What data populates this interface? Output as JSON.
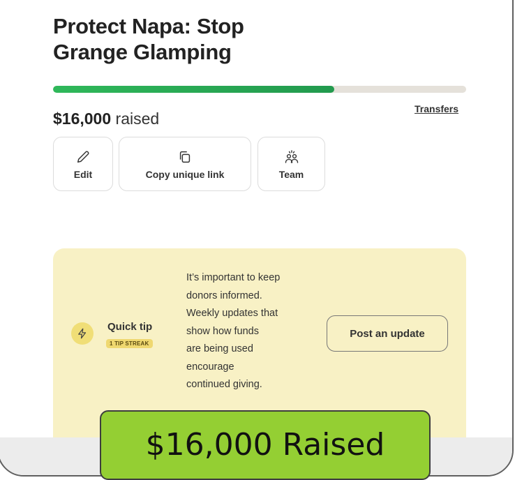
{
  "campaign": {
    "title_line1": "Protect Napa: Stop",
    "title_line2": "Grange Glamping",
    "progress_fraction": 0.68,
    "raised_amount": "$16,000",
    "raised_suffix": " raised",
    "transfers_link": "Transfers"
  },
  "actions": {
    "edit": "Edit",
    "copy_link": "Copy unique link",
    "team": "Team"
  },
  "tip": {
    "label": "Quick tip",
    "streak": "1 TIP STREAK",
    "lines": [
      "It’s important to keep",
      "donors informed.",
      "Weekly updates that",
      "show how funds",
      "are being used",
      "encourage",
      "continued giving."
    ],
    "button": "Post an update"
  },
  "overlay": {
    "text": "$16,000 Raised"
  },
  "colors": {
    "progress": "#229a4e",
    "tip_bg": "#f8f1c5",
    "badge": "#94cf33"
  }
}
